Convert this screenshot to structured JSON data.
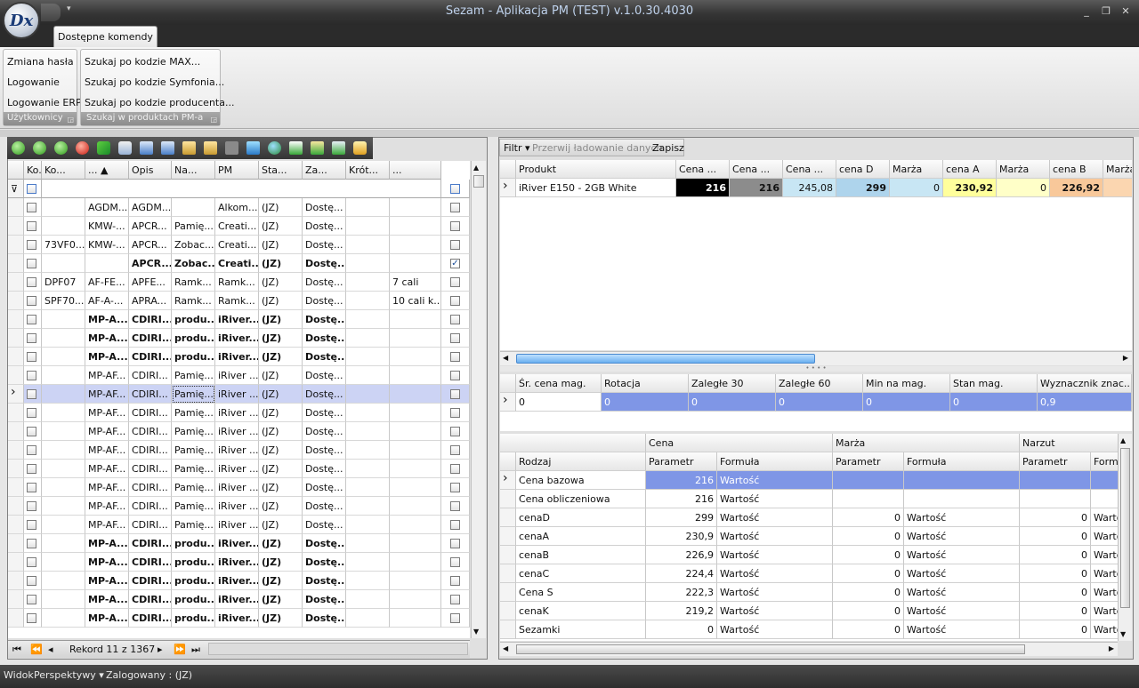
{
  "window": {
    "title": "Sezam - Aplikacja PM (TEST) v.1.0.30.4030"
  },
  "ribbon": {
    "tab": "Dostępne komendy",
    "groups": [
      {
        "caption": "Użytkownicy",
        "items": [
          "Zmiana hasła",
          "Logowanie",
          "Logowanie ERP"
        ]
      },
      {
        "caption": "Szukaj w produktach PM-a",
        "items": [
          "Szukaj po kodzie MAX...",
          "Szukaj po kodzie Symfonia...",
          "Szukaj po kodzie producenta..."
        ]
      }
    ]
  },
  "left_grid": {
    "columns": [
      "",
      "Ko...",
      "Ko...",
      "... ▲",
      "Opis",
      "Na...",
      "PM",
      "Sta...",
      "Za...",
      "Krót...",
      "..."
    ],
    "rows": [
      {
        "c": [
          "",
          "AGDM...",
          "AGDM...",
          "",
          "Alkom...",
          "(JZ)",
          "Dostę...",
          "",
          ""
        ],
        "b": false,
        "chk": false
      },
      {
        "c": [
          "",
          "KMW-...",
          "APCR...",
          "Pamię...",
          "Creati...",
          "(JZ)",
          "Dostę...",
          "",
          ""
        ],
        "b": false,
        "chk": false
      },
      {
        "c": [
          "73VF0...",
          "KMW-...",
          "APCR...",
          "Zobac...",
          "Creati...",
          "(JZ)",
          "Dostę...",
          "",
          ""
        ],
        "b": false,
        "chk": false
      },
      {
        "c": [
          "",
          "",
          "APCR...",
          "Zobac...",
          "Creati...",
          "(JZ)",
          "Dostę...",
          "",
          ""
        ],
        "b": true,
        "chk": true
      },
      {
        "c": [
          "DPF07",
          "AF-FE...",
          "APFE...",
          "Ramk...",
          "Ramk...",
          "(JZ)",
          "Dostę...",
          "",
          "7 cali"
        ],
        "b": false,
        "chk": false
      },
      {
        "c": [
          "SPF70...",
          "AF-A-...",
          "APRA...",
          "Ramk...",
          "Ramk...",
          "(JZ)",
          "Dostę...",
          "",
          "10 cali k..."
        ],
        "b": false,
        "chk": false
      },
      {
        "c": [
          "",
          "MP-A...",
          "CDIRI...",
          "produ...",
          "iRiver...",
          "(JZ)",
          "Dostę...",
          "",
          ""
        ],
        "b": true,
        "chk": false
      },
      {
        "c": [
          "",
          "MP-A...",
          "CDIRI...",
          "produ...",
          "iRiver...",
          "(JZ)",
          "Dostę...",
          "",
          ""
        ],
        "b": true,
        "chk": false
      },
      {
        "c": [
          "",
          "MP-A...",
          "CDIRI...",
          "produ...",
          "iRiver...",
          "(JZ)",
          "Dostę...",
          "",
          ""
        ],
        "b": true,
        "chk": false
      },
      {
        "c": [
          "",
          "MP-AF...",
          "CDIRI...",
          "Pamię...",
          "iRiver ...",
          "(JZ)",
          "Dostę...",
          "",
          ""
        ],
        "b": false,
        "chk": false
      },
      {
        "c": [
          "",
          "MP-AF...",
          "CDIRI...",
          "Pamię...",
          "iRiver ...",
          "(JZ)",
          "Dostę...",
          "",
          ""
        ],
        "b": false,
        "chk": false,
        "sel": true
      },
      {
        "c": [
          "",
          "MP-AF...",
          "CDIRI...",
          "Pamię...",
          "iRiver ...",
          "(JZ)",
          "Dostę...",
          "",
          ""
        ],
        "b": false,
        "chk": false
      },
      {
        "c": [
          "",
          "MP-AF...",
          "CDIRI...",
          "Pamię...",
          "iRiver ...",
          "(JZ)",
          "Dostę...",
          "",
          ""
        ],
        "b": false,
        "chk": false
      },
      {
        "c": [
          "",
          "MP-AF...",
          "CDIRI...",
          "Pamię...",
          "iRiver ...",
          "(JZ)",
          "Dostę...",
          "",
          ""
        ],
        "b": false,
        "chk": false
      },
      {
        "c": [
          "",
          "MP-AF...",
          "CDIRI...",
          "Pamię...",
          "iRiver ...",
          "(JZ)",
          "Dostę...",
          "",
          ""
        ],
        "b": false,
        "chk": false
      },
      {
        "c": [
          "",
          "MP-AF...",
          "CDIRI...",
          "Pamię...",
          "iRiver ...",
          "(JZ)",
          "Dostę...",
          "",
          ""
        ],
        "b": false,
        "chk": false
      },
      {
        "c": [
          "",
          "MP-AF...",
          "CDIRI...",
          "Pamię...",
          "iRiver ...",
          "(JZ)",
          "Dostę...",
          "",
          ""
        ],
        "b": false,
        "chk": false
      },
      {
        "c": [
          "",
          "MP-AF...",
          "CDIRI...",
          "Pamię...",
          "iRiver ...",
          "(JZ)",
          "Dostę...",
          "",
          ""
        ],
        "b": false,
        "chk": false
      },
      {
        "c": [
          "",
          "MP-A...",
          "CDIRI...",
          "produ...",
          "iRiver...",
          "(JZ)",
          "Dostę...",
          "",
          ""
        ],
        "b": true,
        "chk": false
      },
      {
        "c": [
          "",
          "MP-A...",
          "CDIRI...",
          "produ...",
          "iRiver...",
          "(JZ)",
          "Dostę...",
          "",
          ""
        ],
        "b": true,
        "chk": false
      },
      {
        "c": [
          "",
          "MP-A...",
          "CDIRI...",
          "produ...",
          "iRiver...",
          "(JZ)",
          "Dostę...",
          "",
          ""
        ],
        "b": true,
        "chk": false
      },
      {
        "c": [
          "",
          "MP-A...",
          "CDIRI...",
          "produ...",
          "iRiver...",
          "(JZ)",
          "Dostę...",
          "",
          ""
        ],
        "b": true,
        "chk": false
      },
      {
        "c": [
          "",
          "MP-A...",
          "CDIRI...",
          "produ...",
          "iRiver...",
          "(JZ)",
          "Dostę...",
          "",
          ""
        ],
        "b": true,
        "chk": false
      }
    ],
    "record_text": "Rekord 11 z 1367"
  },
  "filterbar": {
    "filter": "Filtr ▾",
    "stop": "Przerwij ładowanie danych",
    "save": "Zapisz"
  },
  "price_grid": {
    "columns": [
      "Produkt",
      "Cena ...",
      "Cena ...",
      "Cena ...",
      "cena D",
      "Marża",
      "cena A",
      "Marża",
      "cena B",
      "Marża"
    ],
    "row": [
      "iRiver E150 - 2GB White",
      "216",
      "216",
      "245,08",
      "299",
      "0",
      "230,92",
      "0",
      "226,92",
      ""
    ],
    "colors": [
      "#ffffff",
      "#000000",
      "#8c8c8c",
      "#c8e6f4",
      "#aed4ec",
      "#c8e6f4",
      "#ffff9c",
      "#ffffc8",
      "#f8c89a",
      "#fbd6b0"
    ]
  },
  "stats_grid": {
    "columns": [
      "Śr. cena mag.",
      "Rotacja",
      "Zaległe 30",
      "Zaległe 60",
      "Min na mag.",
      "Stan mag.",
      "Wyznacznik znac..."
    ],
    "row": [
      "0",
      "0",
      "0",
      "0",
      "0",
      "0",
      "0,9"
    ]
  },
  "calc_grid": {
    "bands": [
      "Cena",
      "Marża",
      "Narzut"
    ],
    "columns": [
      "Rodzaj",
      "Parametr",
      "Formuła",
      "Parametr",
      "Formuła",
      "Parametr",
      "Form"
    ],
    "rows": [
      [
        "Cena bazowa",
        "216",
        "Wartość",
        "",
        "",
        "",
        ""
      ],
      [
        "Cena obliczeniowa",
        "216",
        "Wartość",
        "",
        "",
        "",
        ""
      ],
      [
        "cenaD",
        "299",
        "Wartość",
        "0",
        "Wartość",
        "0",
        "Warto"
      ],
      [
        "cenaA",
        "230,9",
        "Wartość",
        "0",
        "Wartość",
        "0",
        "Warto"
      ],
      [
        "cenaB",
        "226,9",
        "Wartość",
        "0",
        "Wartość",
        "0",
        "Warto"
      ],
      [
        "cenaC",
        "224,4",
        "Wartość",
        "0",
        "Wartość",
        "0",
        "Warto"
      ],
      [
        "Cena S",
        "222,3",
        "Wartość",
        "0",
        "Wartość",
        "0",
        "Warto"
      ],
      [
        "cenaK",
        "219,2",
        "Wartość",
        "0",
        "Wartość",
        "0",
        "Warto"
      ],
      [
        "Sezamki",
        "0",
        "Wartość",
        "0",
        "Wartość",
        "0",
        "Warto"
      ]
    ]
  },
  "statusbar": {
    "view": "Widok",
    "perspective": "Perspektywy ▾",
    "logged": "Zalogowany : (JZ)"
  }
}
